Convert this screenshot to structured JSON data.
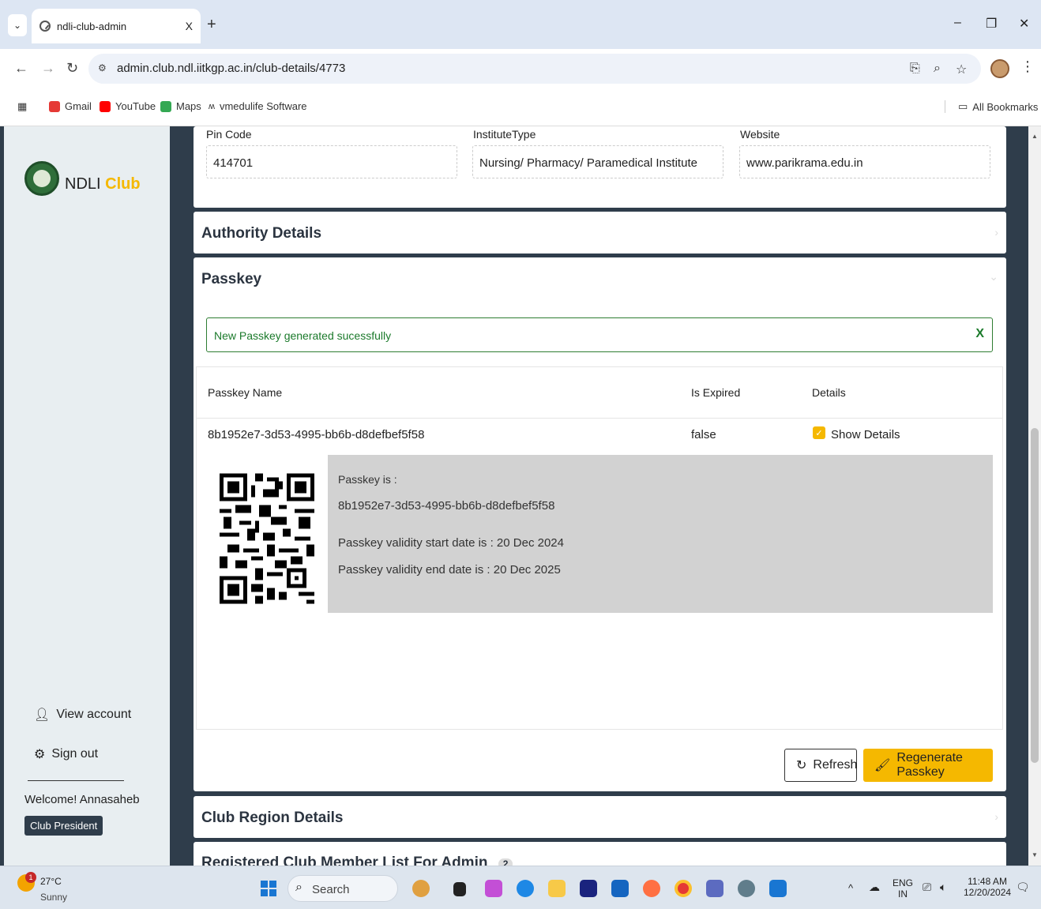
{
  "browser": {
    "tab_title": "ndli-club-admin",
    "tab_close": "X",
    "new_tab": "+",
    "url": "admin.club.ndl.iitkgp.ac.in/club-details/4773",
    "bookmarks": [
      "Gmail",
      "YouTube",
      "Maps",
      "vmedulife Software"
    ],
    "all_bookmarks": "All Bookmarks"
  },
  "sidebar": {
    "brand_main": "NDLI",
    "brand_accent": "Club",
    "view_account": "View account",
    "sign_out": "Sign out",
    "welcome": "Welcome! Annasaheb",
    "role": "Club President"
  },
  "institute": {
    "pin_label": "Pin Code",
    "pin_value": "414701",
    "type_label": "InstituteType",
    "type_value": "Nursing/ Pharmacy/ Paramedical Institute",
    "website_label": "Website",
    "website_value": "www.parikrama.edu.in"
  },
  "sections": {
    "authority": "Authority Details",
    "passkey": "Passkey",
    "club_region": "Club Region Details",
    "member_list": "Registered Club Member List For Admin",
    "member_count": "2"
  },
  "passkey": {
    "alert": "New Passkey generated sucessfully",
    "alert_close": "X",
    "headers": [
      "Passkey Name",
      "Is Expired",
      "Details"
    ],
    "row": {
      "name": "8b1952e7-3d53-4995-bb6b-d8defbef5f58",
      "expired": "false",
      "details_label": "Show Details",
      "details_checked": true
    },
    "detail": {
      "label": "Passkey is :",
      "value": "8b1952e7-3d53-4995-bb6b-d8defbef5f58",
      "start": "Passkey validity start date is : 20 Dec 2024",
      "end": "Passkey validity end date is : 20 Dec 2025"
    },
    "refresh": "Refresh",
    "regenerate": "Regenerate Passkey"
  },
  "taskbar": {
    "temp": "27°C",
    "weather": "Sunny",
    "weather_badge": "1",
    "search": "Search",
    "lang": "ENG",
    "region": "IN",
    "time": "11:48 AM",
    "date": "12/20/2024"
  },
  "colors": {
    "accent": "#f5b800",
    "sidebar_bg": "#e8eef1",
    "page_bg": "#2f3d4b",
    "success": "#1b7a2b"
  }
}
